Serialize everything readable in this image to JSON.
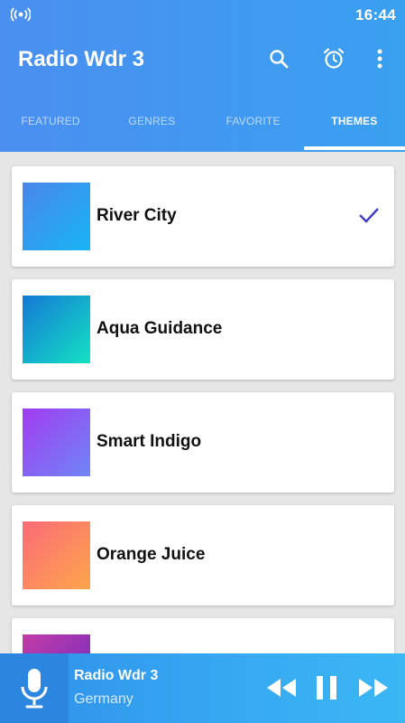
{
  "status": {
    "time": "16:44"
  },
  "toolbar": {
    "title": "Radio Wdr 3"
  },
  "tabs": [
    {
      "label": "FEATURED"
    },
    {
      "label": "GENRES"
    },
    {
      "label": "FAVORITE"
    },
    {
      "label": "THEMES",
      "active": true
    }
  ],
  "themes": [
    {
      "name": "River City",
      "selected": true,
      "colors": [
        "#4a86ea",
        "#17b5f6"
      ]
    },
    {
      "name": "Aqua Guidance",
      "colors": [
        "#1478d6",
        "#13e2c2"
      ]
    },
    {
      "name": "Smart Indigo",
      "colors": [
        "#a23cf0",
        "#6f86f7"
      ]
    },
    {
      "name": "Orange Juice",
      "colors": [
        "#fb6b78",
        "#fca64a"
      ]
    },
    {
      "name": "",
      "colors": [
        "#c43ca6",
        "#6a2bc4"
      ]
    }
  ],
  "player": {
    "station": "Radio Wdr 3",
    "country": "Germany"
  },
  "colors": {
    "accent": "#3a94ef",
    "check": "#3f3cc9"
  }
}
